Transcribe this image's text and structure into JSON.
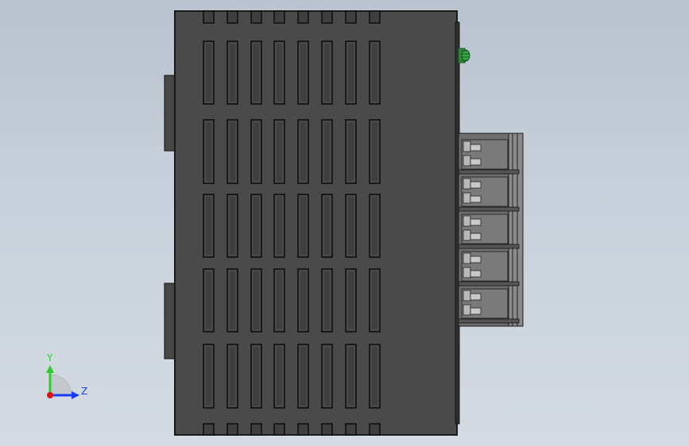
{
  "triad": {
    "y_label": "Y",
    "z_label": "Z",
    "y_color": "#2ecc2e",
    "z_color": "#1a3cff",
    "x_color": "#e01010"
  },
  "colors": {
    "body_fill": "#4a4a4a",
    "body_stroke": "#1a1a1a",
    "slot_stroke": "#111111",
    "terminal_fill": "#9a9a9a",
    "screw_color": "#3aa84a"
  }
}
